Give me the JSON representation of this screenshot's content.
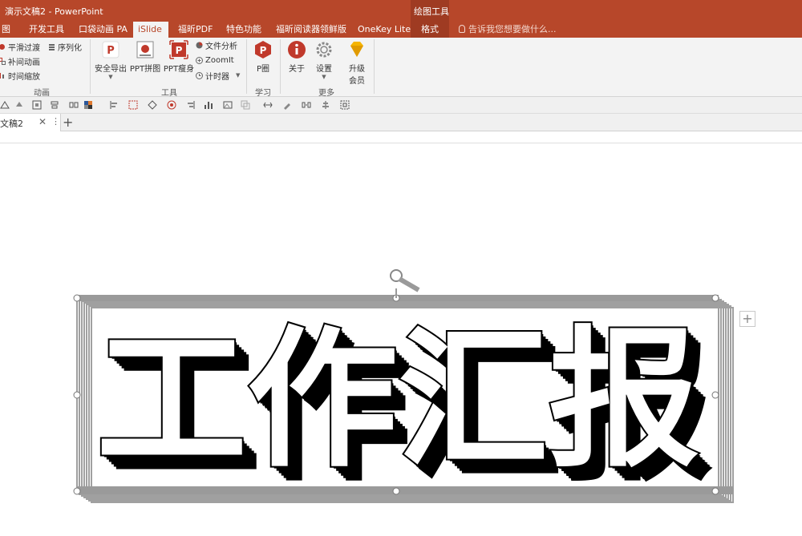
{
  "window": {
    "title": "演示文稿2 - PowerPoint",
    "context_group": "绘图工具"
  },
  "tabs": [
    {
      "label": "图"
    },
    {
      "label": "开发工具"
    },
    {
      "label": "口袋动画 PA"
    },
    {
      "label": "iSlide"
    },
    {
      "label": "福昕PDF"
    },
    {
      "label": "特色功能"
    },
    {
      "label": "福昕阅读器领鲜版"
    },
    {
      "label": "OneKey Lite"
    },
    {
      "label": "格式"
    }
  ],
  "tell_me": "告诉我您想要做什么...",
  "ribbon": {
    "animation": {
      "label": "动画",
      "items": [
        "平滑过渡",
        "序列化",
        "补间动画",
        "时间缩放"
      ]
    },
    "tools": {
      "label": "工具",
      "big": [
        "安全导出",
        "PPT拼图",
        "PPT瘦身"
      ],
      "small": [
        "文件分析",
        "ZoomIt",
        "计时器"
      ]
    },
    "learn": {
      "label": "学习",
      "big": [
        "P圈"
      ]
    },
    "more": {
      "label": "更多",
      "big": [
        "关于",
        "设置",
        "升级",
        "会员"
      ]
    }
  },
  "document": {
    "tab_name": "文稿2"
  },
  "slide": {
    "text": "工作汇报"
  },
  "colors": {
    "accent": "#b7472a",
    "context": "#9f3b22",
    "ribbon": "#f3f3f3",
    "selection": "#9a9a9a"
  }
}
